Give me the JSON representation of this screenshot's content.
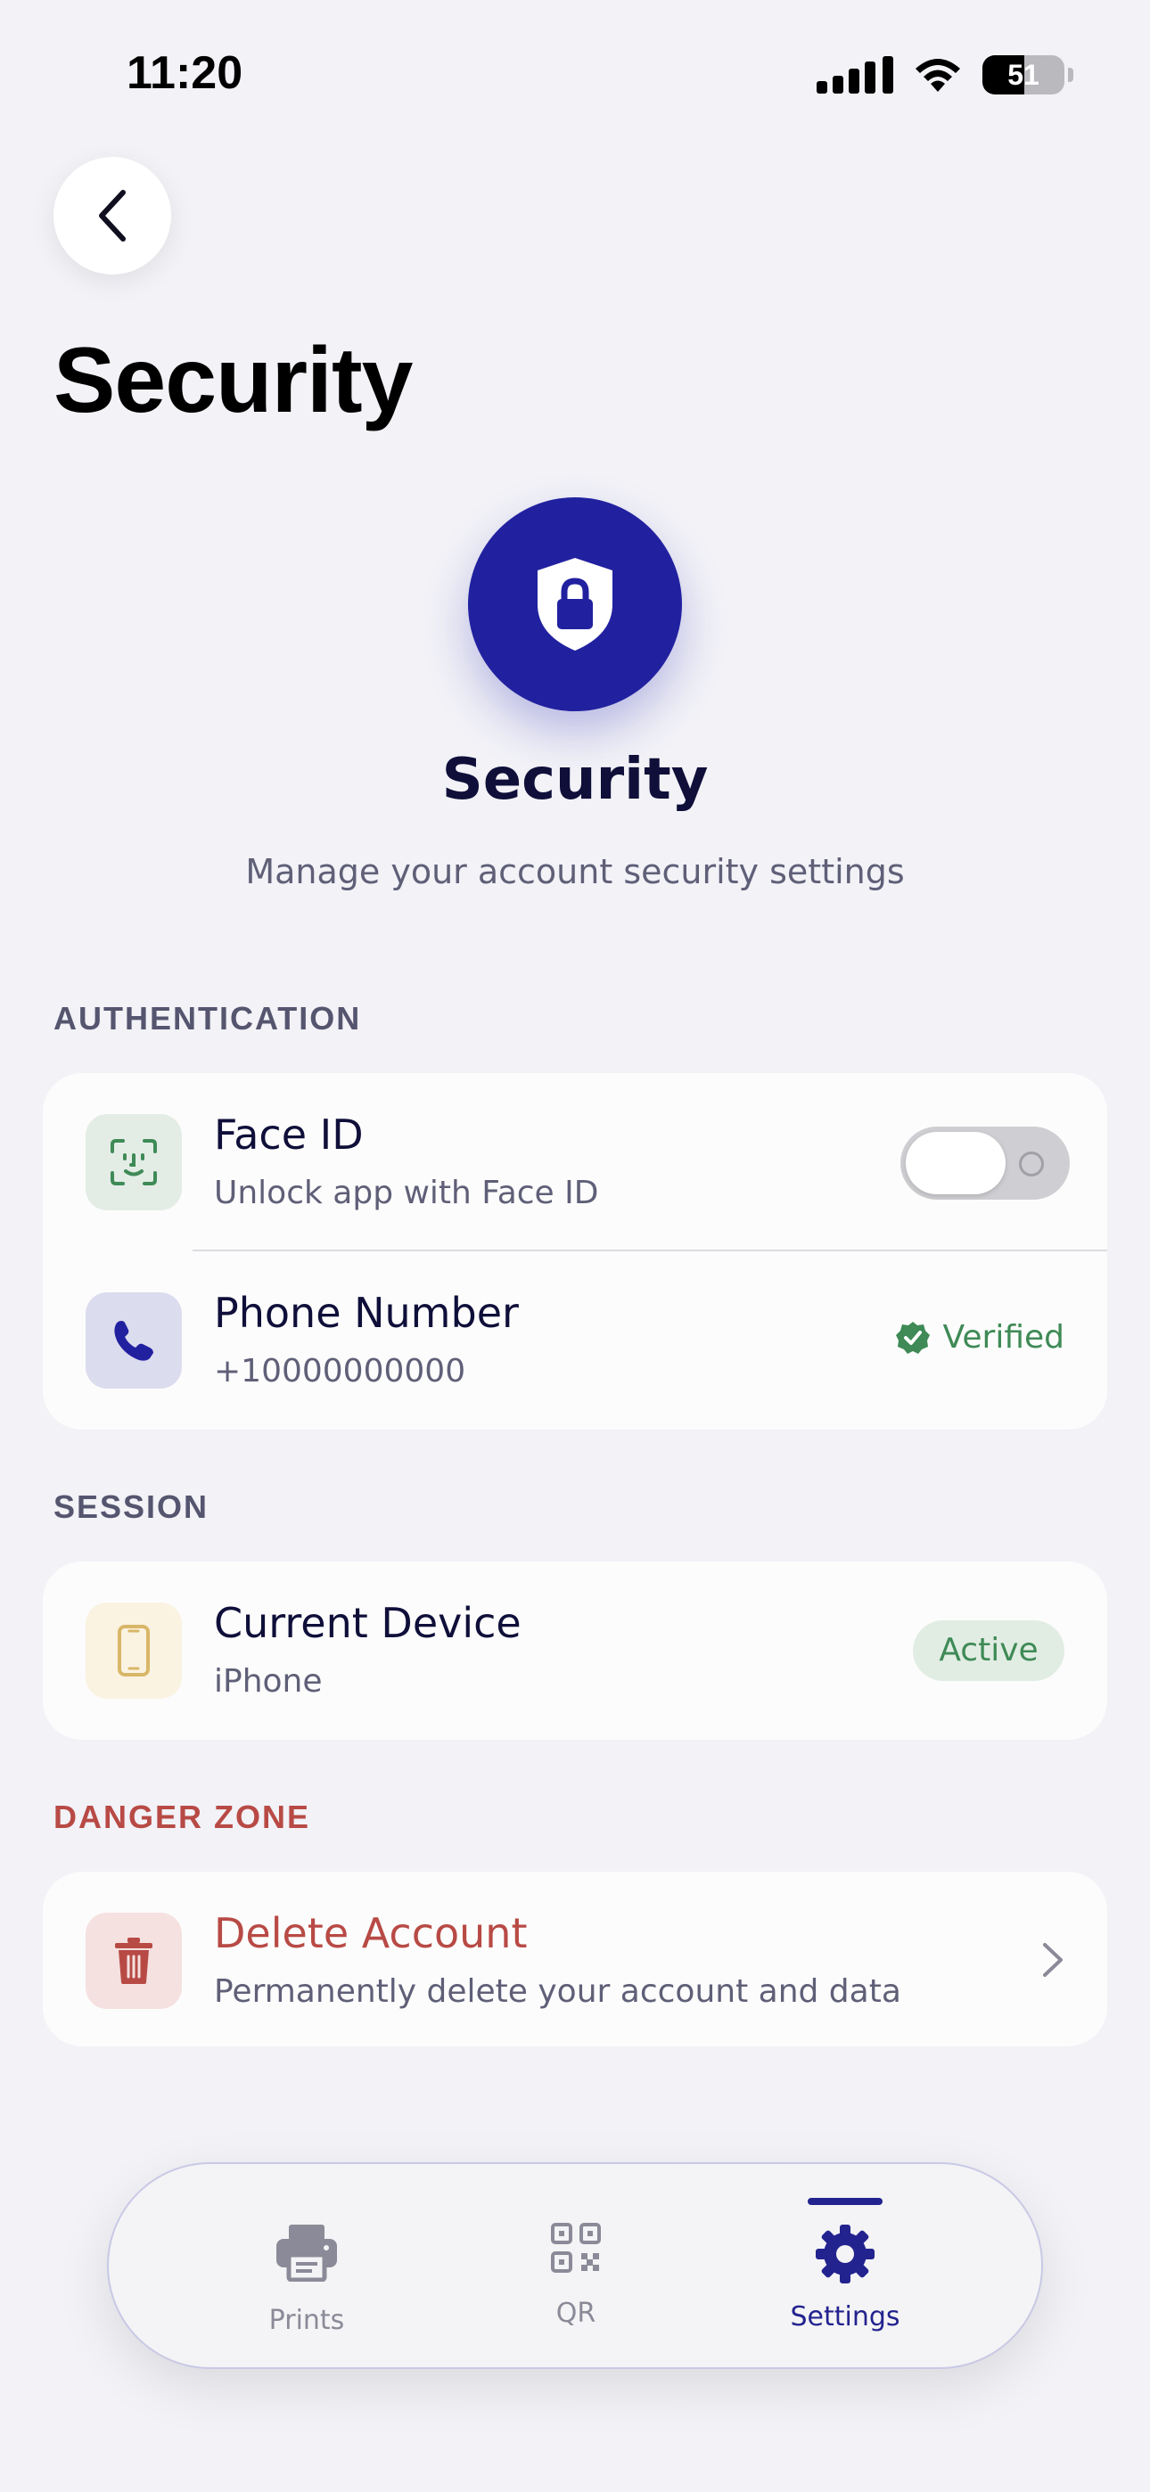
{
  "status_bar": {
    "time": "11:20",
    "battery": "51",
    "battery_level": 0.51
  },
  "header": {
    "title": "Security"
  },
  "hero": {
    "title": "Security",
    "subtitle": "Manage your account security settings"
  },
  "sections": {
    "authentication": {
      "label": "AUTHENTICATION",
      "face_id": {
        "title": "Face ID",
        "subtitle": "Unlock app with Face ID",
        "enabled": false
      },
      "phone": {
        "title": "Phone Number",
        "subtitle": "+10000000000",
        "status": "Verified"
      }
    },
    "session": {
      "label": "SESSION",
      "device": {
        "title": "Current Device",
        "subtitle": "iPhone",
        "status": "Active"
      }
    },
    "danger": {
      "label": "DANGER ZONE",
      "delete": {
        "title": "Delete Account",
        "subtitle": "Permanently delete your account and data"
      }
    }
  },
  "tabs": [
    {
      "label": "Prints",
      "icon": "printer-icon",
      "active": false
    },
    {
      "label": "QR",
      "icon": "qr-code-icon",
      "active": false
    },
    {
      "label": "Settings",
      "icon": "gear-icon",
      "active": true
    }
  ],
  "colors": {
    "accent": "#2121a0",
    "success": "#3f8a56",
    "danger": "#b84a45",
    "background": "#f2f2f7"
  }
}
